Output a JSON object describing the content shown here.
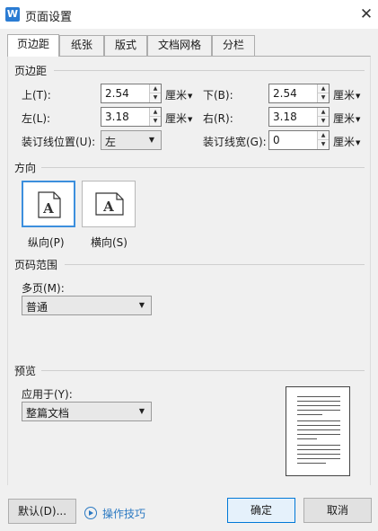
{
  "window": {
    "title": "页面设置",
    "app_icon_letter": "W",
    "close_glyph": "✕"
  },
  "tabs": [
    {
      "label": "页边距",
      "active": true
    },
    {
      "label": "纸张",
      "active": false
    },
    {
      "label": "版式",
      "active": false
    },
    {
      "label": "文档网格",
      "active": false
    },
    {
      "label": "分栏",
      "active": false
    }
  ],
  "margins": {
    "section_title": "页边距",
    "top_label": "上(T):",
    "top_value": "2.54",
    "bottom_label": "下(B):",
    "bottom_value": "2.54",
    "left_label": "左(L):",
    "left_value": "3.18",
    "right_label": "右(R):",
    "right_value": "3.18",
    "gutter_pos_label": "装订线位置(U):",
    "gutter_pos_value": "左",
    "gutter_width_label": "装订线宽(G):",
    "gutter_width_value": "0",
    "unit": "厘米"
  },
  "orientation": {
    "section_title": "方向",
    "portrait_label": "纵向(P)",
    "landscape_label": "横向(S)",
    "icon_letter": "A",
    "selected": "portrait"
  },
  "page_range": {
    "section_title": "页码范围",
    "multi_label": "多页(M):",
    "multi_value": "普通"
  },
  "preview": {
    "section_title": "预览",
    "apply_label": "应用于(Y):",
    "apply_value": "整篇文档"
  },
  "footer": {
    "default_button": "默认(D)...",
    "tips_link": "操作技巧",
    "ok_button": "确定",
    "cancel_button": "取消"
  },
  "colors": {
    "accent": "#3c8fdd",
    "link": "#2b79c2",
    "app_icon": "#2b7cd3"
  }
}
